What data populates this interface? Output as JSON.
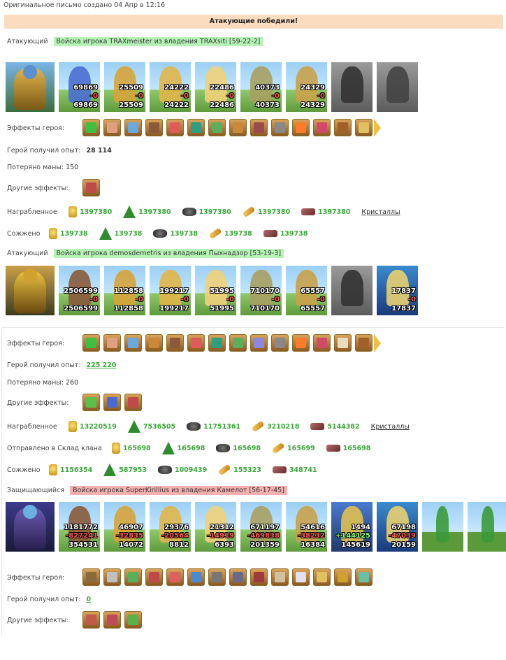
{
  "meta": "Оригинальное письмо создано 04 Апр в 12:16",
  "result": "Атакующие победили!",
  "labels": {
    "effects": "Эффекты героя:",
    "exp": "Герой получил опыт:",
    "mana": "Потеряно маны:",
    "other": "Другие эффекты:",
    "loot": "Награбленное",
    "burned": "Сожжено",
    "sent": "Отправлено в Склад клана",
    "crystals": "Кристаллы"
  },
  "a1": {
    "role": "Атакующий",
    "tag": "Войска игрока TRAXmeister из владения TRAXsiti [59-22-2]",
    "units": [
      {
        "top": "69869",
        "mid": "-0",
        "bot": "69869"
      },
      {
        "top": "25509",
        "mid": "-0",
        "bot": "25509"
      },
      {
        "top": "24222",
        "mid": "-0",
        "bot": "24222"
      },
      {
        "top": "22486",
        "mid": "-0",
        "bot": "22486"
      },
      {
        "top": "40373",
        "mid": "-0",
        "bot": "40373"
      },
      {
        "top": "24329",
        "mid": "-0",
        "bot": "24329"
      }
    ],
    "exp": "28 114",
    "mana": "150",
    "loot": [
      "1397380",
      "1397380",
      "1397380",
      "1397380",
      "1397380"
    ],
    "burned": [
      "139738",
      "139738",
      "139738",
      "139738",
      "139738"
    ]
  },
  "a2": {
    "role": "Атакующий",
    "tag": "Войска игрока demosdemetris из владения Пыхнадзор [53-19-3]",
    "units": [
      {
        "top": "2506599",
        "mid": "-0",
        "bot": "2506599"
      },
      {
        "top": "112858",
        "mid": "-0",
        "bot": "112858"
      },
      {
        "top": "199217",
        "mid": "-0",
        "bot": "199217"
      },
      {
        "top": "51995",
        "mid": "-0",
        "bot": "51995"
      },
      {
        "top": "710170",
        "mid": "-0",
        "bot": "710170"
      },
      {
        "top": "65557",
        "mid": "-0",
        "bot": "65557"
      },
      {
        "top": "",
        "mid": "",
        "bot": ""
      },
      {
        "top": "17837",
        "mid": "-0",
        "bot": "17837"
      }
    ],
    "exp": "225 220",
    "mana": "260",
    "loot": [
      "13220519",
      "7536505",
      "11751361",
      "3210218",
      "5144382"
    ],
    "sent": [
      "165698",
      "165698",
      "165698",
      "165699",
      "165698"
    ],
    "burned": [
      "1156354",
      "587953",
      "1009439",
      "155323",
      "348741"
    ]
  },
  "d1": {
    "role": "Защищающийся",
    "tag": "Войска игрока SuperKirillius из владения Камелот [56-17-45]",
    "units": [
      {
        "top": "1181772",
        "mid": "-827241",
        "bot": "354531",
        "midc": "red"
      },
      {
        "top": "46907",
        "mid": "-32835",
        "bot": "14072",
        "midc": "red"
      },
      {
        "top": "29376",
        "mid": "-20564",
        "bot": "8812",
        "midc": "red"
      },
      {
        "top": "21312",
        "mid": "-14919",
        "bot": "6393",
        "midc": "red"
      },
      {
        "top": "671197",
        "mid": "-469838",
        "bot": "201359",
        "midc": "red"
      },
      {
        "top": "54616",
        "mid": "-38232",
        "bot": "16384",
        "midc": "red"
      },
      {
        "top": "1494",
        "mid": "+144125",
        "bot": "145619",
        "midc": "grn"
      },
      {
        "top": "67198",
        "mid": "-47039",
        "bot": "20159",
        "midc": "red"
      }
    ],
    "exp": "0"
  },
  "colors": {
    "accent": "#3aa83a",
    "banner": "#fbdcbf",
    "attacker_tag": "#b5f4b5",
    "defender_tag": "#f6b0b0"
  }
}
